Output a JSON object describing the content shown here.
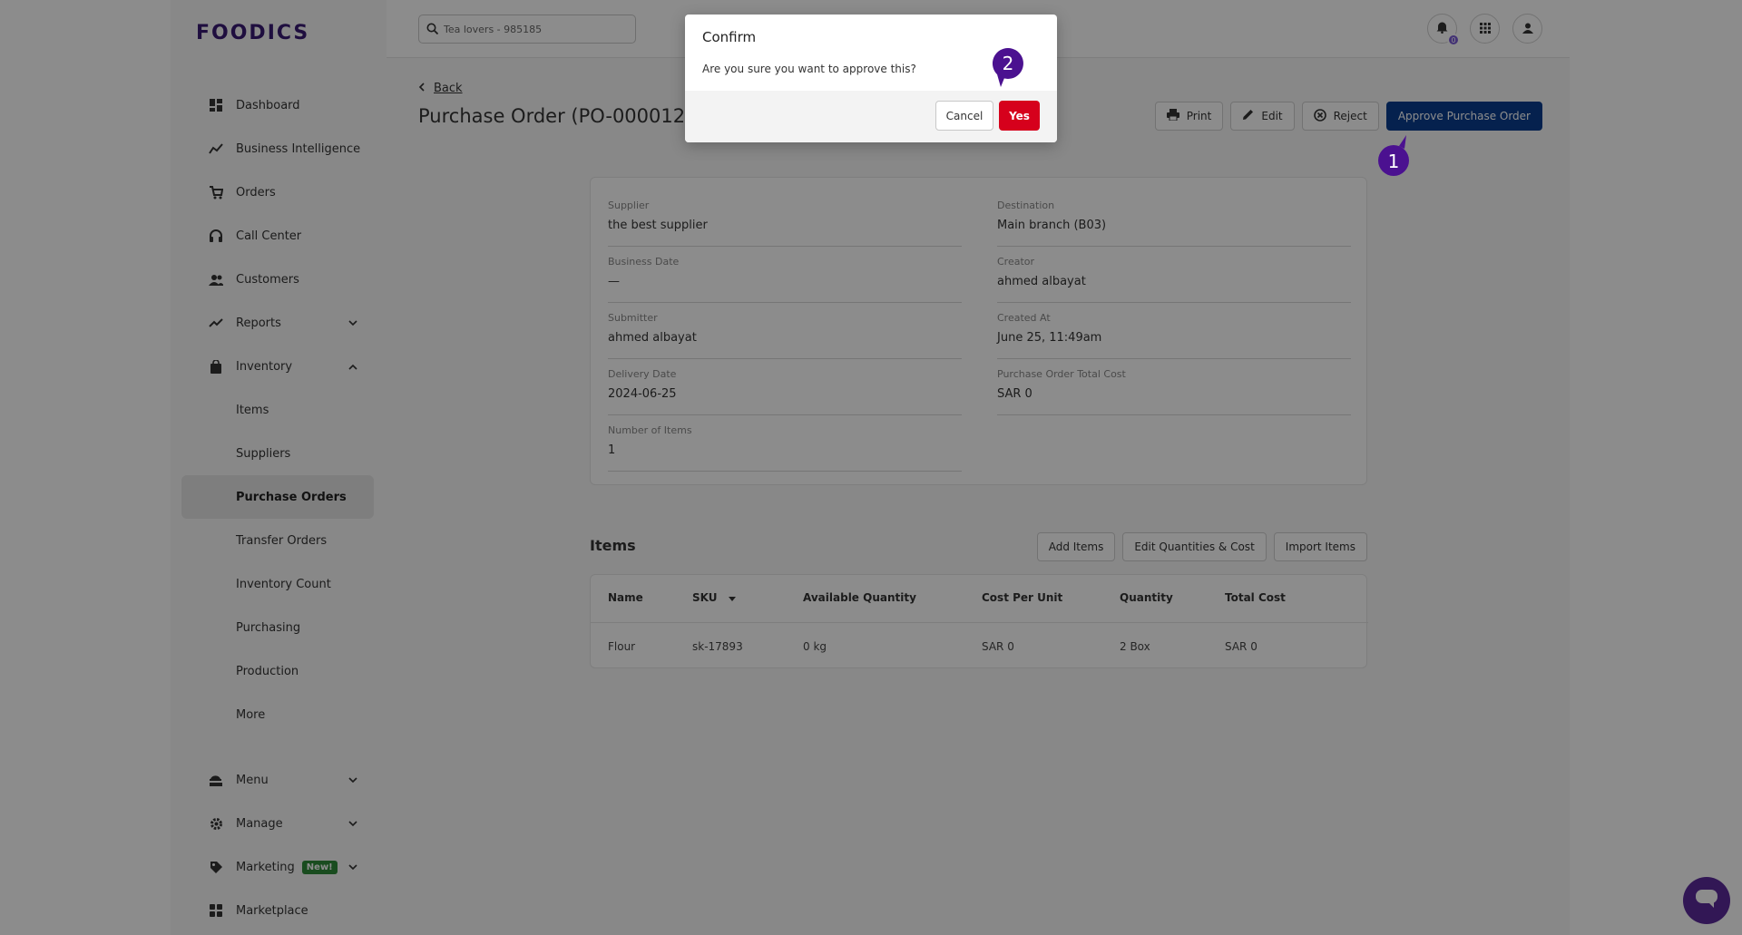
{
  "brand": {
    "logo": "FOODICS"
  },
  "search": {
    "value": "Tea lovers - 985185"
  },
  "notifications": {
    "count": "0"
  },
  "sidebar": {
    "items": [
      {
        "label": "Dashboard",
        "icon": "dashboard-icon"
      },
      {
        "label": "Business Intelligence",
        "icon": "chart-line-icon"
      },
      {
        "label": "Orders",
        "icon": "cart-icon"
      },
      {
        "label": "Call Center",
        "icon": "headset-icon"
      },
      {
        "label": "Customers",
        "icon": "users-icon"
      },
      {
        "label": "Reports",
        "icon": "trend-icon"
      },
      {
        "label": "Inventory",
        "icon": "bag-icon"
      },
      {
        "label": "Items"
      },
      {
        "label": "Suppliers"
      },
      {
        "label": "Purchase Orders"
      },
      {
        "label": "Transfer Orders"
      },
      {
        "label": "Inventory Count"
      },
      {
        "label": "Purchasing"
      },
      {
        "label": "Production"
      },
      {
        "label": "More"
      },
      {
        "label": "Menu",
        "icon": "menu-icon"
      },
      {
        "label": "Manage",
        "icon": "gear-icon"
      },
      {
        "label": "Marketing",
        "icon": "tag-icon",
        "badge": "New!"
      },
      {
        "label": "Marketplace",
        "icon": "grid-icon"
      }
    ]
  },
  "header": {
    "back_label": "Back",
    "title": "Purchase Order (PO-000012)",
    "actions": {
      "print": "Print",
      "edit": "Edit",
      "reject": "Reject",
      "approve": "Approve Purchase Order"
    }
  },
  "details": {
    "supplier": {
      "label": "Supplier",
      "value": "the best supplier"
    },
    "destination": {
      "label": "Destination",
      "value": "Main branch (B03)"
    },
    "business_date": {
      "label": "Business Date",
      "value": "—"
    },
    "creator": {
      "label": "Creator",
      "value": "ahmed albayat"
    },
    "submitter": {
      "label": "Submitter",
      "value": "ahmed albayat"
    },
    "created_at": {
      "label": "Created At",
      "value": "June 25, 11:49am"
    },
    "delivery_date": {
      "label": "Delivery Date",
      "value": "2024-06-25"
    },
    "total_cost": {
      "label": "Purchase Order Total Cost",
      "value": "SAR 0"
    },
    "num_items": {
      "label": "Number of Items",
      "value": "1"
    }
  },
  "items": {
    "title": "Items",
    "actions": {
      "add": "Add Items",
      "edit_qty": "Edit Quantities & Cost",
      "import": "Import Items"
    },
    "columns": [
      "Name",
      "SKU",
      "Available Quantity",
      "Cost Per Unit",
      "Quantity",
      "Total Cost"
    ],
    "rows": [
      [
        "Flour",
        "sk-17893",
        "0 kg",
        "SAR 0",
        "2 Box",
        "SAR 0"
      ]
    ]
  },
  "dialog": {
    "title": "Confirm",
    "message": "Are you sure you want to approve this?",
    "cancel": "Cancel",
    "yes": "Yes"
  },
  "markers": {
    "first": "1",
    "second": "2"
  },
  "colors": {
    "accent": "#0a3d8f",
    "danger": "#d6001c",
    "marker": "#4b1190",
    "brand": "#3a1a74"
  }
}
